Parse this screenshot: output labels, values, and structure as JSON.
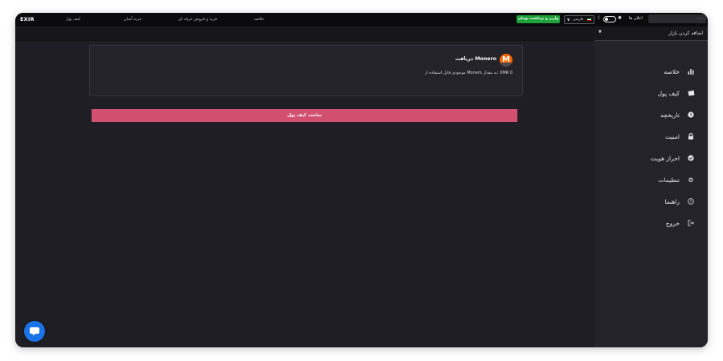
{
  "header": {
    "logo": "EXIR",
    "nav": [
      "کیف پول",
      "خرید آسان",
      "خرید و فروش حرفه ای",
      "خلاصه"
    ],
    "deposit_button": "واریز و برداشت تومان",
    "language": "فارسی",
    "notifications": "اعلان ها",
    "user": "......."
  },
  "sidebar": {
    "add_market": "اضافه کردن بازار",
    "items": [
      {
        "label": "خلاصه",
        "icon": "bar-chart-icon"
      },
      {
        "label": "کیف پول",
        "icon": "wallet-icon"
      },
      {
        "label": "تاریخچه",
        "icon": "history-icon"
      },
      {
        "label": "امنیت",
        "icon": "lock-icon"
      },
      {
        "label": "احراز هویت",
        "icon": "verified-icon"
      },
      {
        "label": "تنظیمات",
        "icon": "gear-icon"
      },
      {
        "label": "راهنما",
        "icon": "help-icon"
      },
      {
        "label": "خروج",
        "icon": "logout-icon"
      }
    ]
  },
  "card": {
    "title": "دریافت Monero",
    "balance": "موجودی قابل استفاده از Monero به مقدار: XMR 0",
    "logo_letter": "M"
  },
  "actions": {
    "create_wallet": "ساخت کیف پول"
  },
  "colors": {
    "accent": "#d24f6f",
    "deposit": "#1da33a",
    "monero": "#ff6600",
    "chat": "#1b73e8"
  }
}
